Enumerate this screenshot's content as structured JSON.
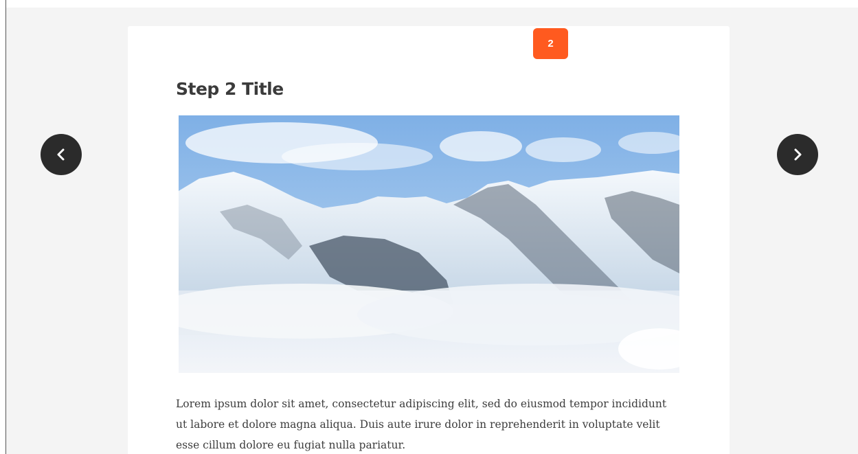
{
  "step": {
    "number": "2",
    "title": "Step 2 Title",
    "description": "Lorem ipsum dolor sit amet, consectetur adipiscing elit, sed do eiusmod tempor incididunt ut labore et dolore magna aliqua. Duis aute irure dolor in reprehenderit in voluptate velit esse cillum dolore eu fugiat nulla pariatur."
  },
  "navigation": {
    "prev_icon": "chevron-left-icon",
    "next_icon": "chevron-right-icon"
  },
  "colors": {
    "accent": "#ff5a1f",
    "nav_button": "#2b2b2b",
    "background": "#f4f4f4",
    "card": "#ffffff"
  }
}
